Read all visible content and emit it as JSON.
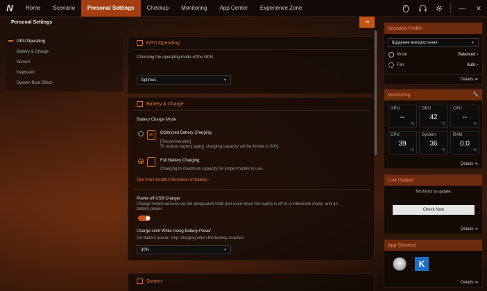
{
  "topbar": {
    "logo": "N",
    "tabs": [
      {
        "label": "Home"
      },
      {
        "label": "Scenario"
      },
      {
        "label": "Personal Settings"
      },
      {
        "label": "Checkup"
      },
      {
        "label": "Monitoring"
      },
      {
        "label": "App Center"
      },
      {
        "label": "Experience Zone"
      }
    ],
    "active_tab": "Personal Settings",
    "window_controls": {
      "minimize": "—",
      "close": "✕"
    }
  },
  "sidebar": {
    "title": "Personal Settings",
    "items": [
      {
        "label": "GPU Operating"
      },
      {
        "label": "Battery & Charge"
      },
      {
        "label": "Screen"
      },
      {
        "label": "Keyboard"
      },
      {
        "label": "System Boot Effect"
      }
    ]
  },
  "gpu": {
    "title": "GPU Operating",
    "description": "Choosing the operating mode of the GPU.",
    "mode_value": "Optimus"
  },
  "battery": {
    "title": "Battery & Charge",
    "mode_label": "Battery Charge Mode",
    "option1_title": "Optimized Battery Charging",
    "option1_badge": "80",
    "option1_recommended": "[Recommended]",
    "option1_desc": "To reduce battery aging, charging capacity will be limited to 80%.",
    "option2_title": "Full Battery Charging",
    "option2_desc": "Charging to maximum capacity for longer mobile to use.",
    "health_link": "See more health information of battery ›",
    "usb_title": "Power-off USB Charger",
    "usb_desc_1": "Charge mobile devices via the designated USB port even when the laptop is off or in Hibernate mode, and on",
    "usb_desc_2": "battery power.",
    "limit_title": "Charge Limit While Using Battery Power",
    "limit_desc": "On battery power, stop charging when the battery reaches:",
    "limit_value": "30%"
  },
  "screen": {
    "title": "Screen"
  },
  "scenario_profile": {
    "title": "Scenario Profile",
    "profile_value": "Щоденне використання",
    "mode_label": "Mode",
    "mode_value": "Balanced ›",
    "fan_label": "Fan",
    "fan_value": "Auto ›",
    "details": "Details ➔"
  },
  "monitoring": {
    "title": "Monitoring",
    "cells": [
      {
        "label": "GPU",
        "value": "--",
        "unit": "%"
      },
      {
        "label": "GPU",
        "value": "42",
        "unit": "°C"
      },
      {
        "label": "CPU",
        "value": "--",
        "unit": "%"
      },
      {
        "label": "CPU",
        "value": "39",
        "unit": "°C"
      },
      {
        "label": "System",
        "value": "36",
        "unit": "°C"
      },
      {
        "label": "RAM",
        "value": "0.0",
        "unit": "%"
      }
    ],
    "details": "Details ➔"
  },
  "live_update": {
    "title": "Live Update",
    "status": "No items to update",
    "check_button": "Check Now",
    "details": "Details ➔"
  },
  "app_shortcut": {
    "title": "App Shortcut",
    "app2_letter": "K",
    "details": "Details ➔"
  },
  "colors": {
    "accent": "#c75516",
    "accent_text": "#e8703a",
    "panel_header": "#6e2a0d"
  }
}
